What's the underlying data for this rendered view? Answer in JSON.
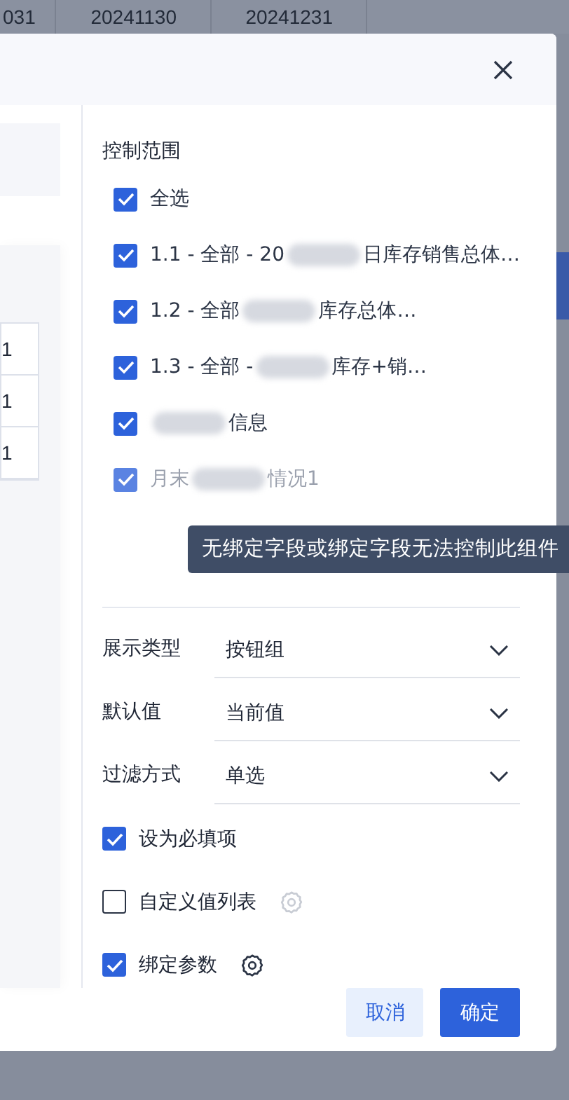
{
  "background_table": {
    "headers": [
      "031",
      "20241130",
      "20241231"
    ]
  },
  "left_pane": {
    "cells": [
      "1",
      "1",
      "1"
    ]
  },
  "scope": {
    "title": "控制范围",
    "items": [
      {
        "checked": true,
        "disabled": false,
        "segments": [
          {
            "kind": "text",
            "text": "全选"
          }
        ]
      },
      {
        "checked": true,
        "disabled": false,
        "segments": [
          {
            "kind": "text",
            "text": "1.1 - 全部 - 20"
          },
          {
            "kind": "blur"
          },
          {
            "kind": "text",
            "text": "日库存销售总体…"
          }
        ]
      },
      {
        "checked": true,
        "disabled": false,
        "segments": [
          {
            "kind": "text",
            "text": "1.2 - 全部"
          },
          {
            "kind": "blur"
          },
          {
            "kind": "text",
            "text": "库存总体…"
          }
        ]
      },
      {
        "checked": true,
        "disabled": false,
        "segments": [
          {
            "kind": "text",
            "text": "1.3 - 全部 -"
          },
          {
            "kind": "blur"
          },
          {
            "kind": "text",
            "text": "库存+销…"
          }
        ]
      },
      {
        "checked": true,
        "disabled": false,
        "segments": [
          {
            "kind": "blur"
          },
          {
            "kind": "text",
            "text": "信息"
          }
        ]
      },
      {
        "checked": true,
        "disabled": true,
        "segments": [
          {
            "kind": "text",
            "text": "月末"
          },
          {
            "kind": "blur"
          },
          {
            "kind": "text",
            "text": "情况1"
          }
        ]
      }
    ]
  },
  "tooltip": "无绑定字段或绑定字段无法控制此组件",
  "fields": [
    {
      "label": "展示类型",
      "value": "按钮组"
    },
    {
      "label": "默认值",
      "value": "当前值"
    },
    {
      "label": "过滤方式",
      "value": "单选"
    }
  ],
  "options": [
    {
      "label": "设为必填项",
      "checked": true,
      "has_settings": false
    },
    {
      "label": "自定义值列表",
      "checked": false,
      "has_settings": true
    },
    {
      "label": "绑定参数",
      "checked": true,
      "has_settings": true
    }
  ],
  "buttons": [
    {
      "label": "取消",
      "kind": "secondary"
    },
    {
      "label": "确定",
      "kind": "primary"
    }
  ]
}
